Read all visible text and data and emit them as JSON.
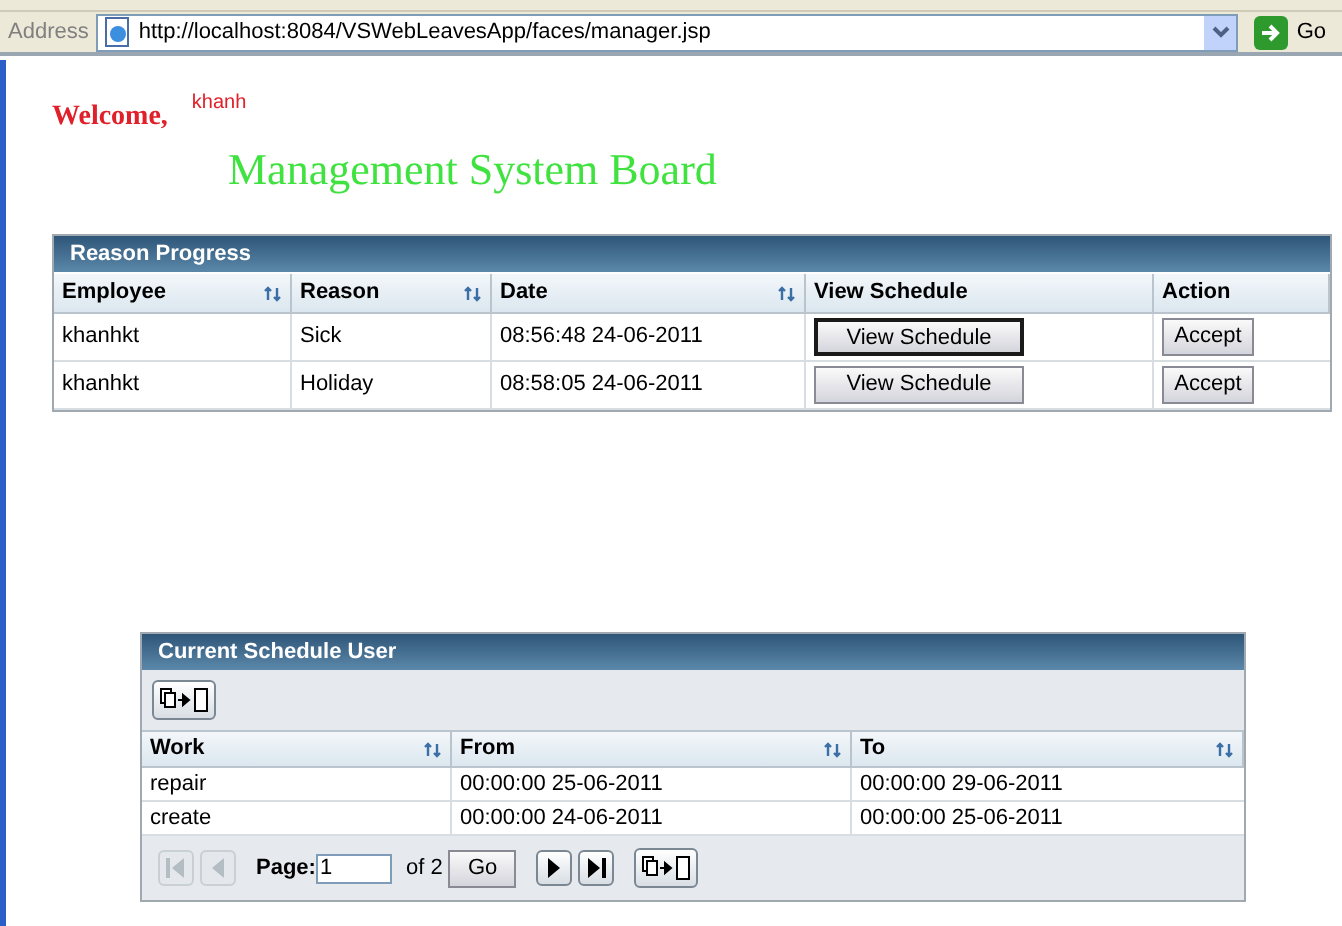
{
  "address_bar": {
    "label": "Address",
    "url": "http://localhost:8084/VSWebLeavesApp/faces/manager.jsp",
    "go": "Go"
  },
  "welcome": {
    "label": "Welcome,",
    "user": "khanh"
  },
  "title": "Management System Board",
  "reason_table": {
    "title": "Reason Progress",
    "columns": [
      {
        "label": "Employee",
        "sortable": true
      },
      {
        "label": "Reason",
        "sortable": true
      },
      {
        "label": "Date",
        "sortable": true
      },
      {
        "label": "View Schedule",
        "sortable": false
      },
      {
        "label": "Action",
        "sortable": false
      }
    ],
    "rows": [
      {
        "employee": "khanhkt",
        "reason": "Sick",
        "date": "08:56:48 24-06-2011",
        "view": "View Schedule",
        "view_focused": true,
        "action": "Accept"
      },
      {
        "employee": "khanhkt",
        "reason": "Holiday",
        "date": "08:58:05 24-06-2011",
        "view": "View Schedule",
        "view_focused": false,
        "action": "Accept"
      }
    ]
  },
  "schedule_table": {
    "title": "Current Schedule User",
    "columns": [
      {
        "label": "Work",
        "sortable": true
      },
      {
        "label": "From",
        "sortable": true
      },
      {
        "label": "To",
        "sortable": true
      }
    ],
    "rows": [
      {
        "work": "repair",
        "from": "00:00:00 25-06-2011",
        "to": "00:00:00 29-06-2011"
      },
      {
        "work": "create",
        "from": "00:00:00 24-06-2011",
        "to": "00:00:00 25-06-2011"
      }
    ],
    "pager": {
      "page_label": "Page:",
      "page_value": "1",
      "of": "of 2",
      "go": "Go",
      "nav": [
        {
          "kind": "first",
          "disabled": true
        },
        {
          "kind": "prev",
          "disabled": true
        },
        {
          "kind": "next",
          "disabled": false
        },
        {
          "kind": "last",
          "disabled": false
        }
      ]
    }
  }
}
